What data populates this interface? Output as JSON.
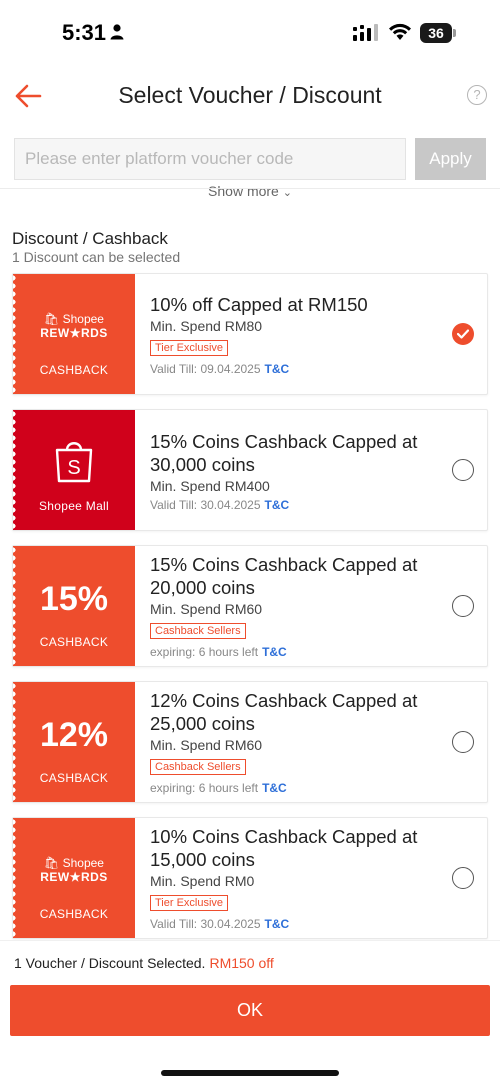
{
  "status_bar": {
    "time": "5:31",
    "battery": "36"
  },
  "header": {
    "title": "Select Voucher / Discount",
    "help": "?"
  },
  "code_input": {
    "placeholder": "Please enter platform voucher code",
    "apply_label": "Apply"
  },
  "show_more": {
    "label": "Show more"
  },
  "section": {
    "title": "Discount / Cashback",
    "subtitle": "1 Discount can be selected"
  },
  "vouchers": [
    {
      "left_kind": "shopee-rewards",
      "logo_line1": "Shopee",
      "logo_line2": "REW★RDS",
      "left_label": "CASHBACK",
      "title": "10% off Capped at RM150",
      "min_spend": "Min. Spend RM80",
      "tag": "Tier Exclusive",
      "validity": "Valid Till: 09.04.2025",
      "tnc": "T&C",
      "selected": true
    },
    {
      "left_kind": "shopee-mall",
      "left_label": "Shopee Mall",
      "title": "15% Coins Cashback Capped at 30,000 coins",
      "min_spend": "Min. Spend RM400",
      "tag": "",
      "validity": "Valid Till: 30.04.2025",
      "tnc": "T&C",
      "selected": false
    },
    {
      "left_kind": "percent",
      "percent": "15%",
      "left_label": "CASHBACK",
      "title": "15% Coins Cashback Capped at 20,000 coins",
      "min_spend": "Min. Spend RM60",
      "tag": "Cashback Sellers",
      "validity": "expiring: 6 hours left",
      "tnc": "T&C",
      "selected": false
    },
    {
      "left_kind": "percent",
      "percent": "12%",
      "left_label": "CASHBACK",
      "title": "12% Coins Cashback Capped at 25,000 coins",
      "min_spend": "Min. Spend RM60",
      "tag": "Cashback Sellers",
      "validity": "expiring: 6 hours left",
      "tnc": "T&C",
      "selected": false
    },
    {
      "left_kind": "shopee-rewards",
      "logo_line1": "Shopee",
      "logo_line2": "REW★RDS",
      "left_label": "CASHBACK",
      "title": "10% Coins Cashback Capped at 15,000 coins",
      "min_spend": "Min. Spend RM0",
      "tag": "Tier Exclusive",
      "validity": "Valid Till: 30.04.2025",
      "tnc": "T&C",
      "selected": false
    }
  ],
  "footer": {
    "selected_text": "1 Voucher / Discount Selected.",
    "selected_amount": "RM150 off",
    "ok_label": "OK"
  },
  "colors": {
    "brand": "#ee4d2d",
    "mall": "#d0011b",
    "link": "#2e6fd8"
  }
}
